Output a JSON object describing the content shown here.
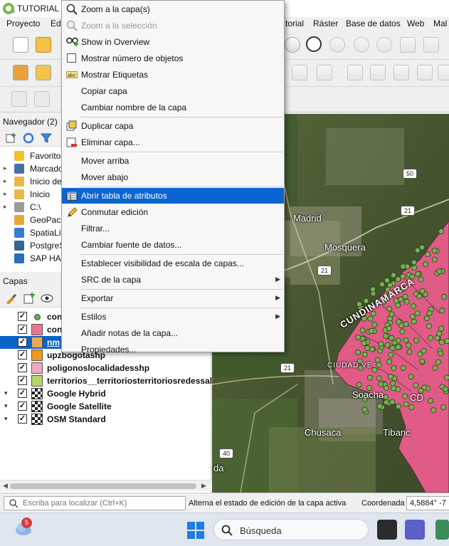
{
  "window": {
    "title": "TUTORIAL M"
  },
  "menubar": [
    "Proyecto",
    "Ed",
    "torial",
    "Ráster",
    "Base de datos",
    "Web",
    "Mal"
  ],
  "navigator": {
    "title": "Navegador (2)",
    "items": [
      {
        "label": "Favorito",
        "icon": "star-icon",
        "arrow": ""
      },
      {
        "label": "Marcado",
        "icon": "bookmark-icon",
        "arrow": "▸"
      },
      {
        "label": "Inicio de",
        "icon": "home-folder-icon",
        "arrow": "▸"
      },
      {
        "label": "Inicio",
        "icon": "folder-icon",
        "arrow": "▸"
      },
      {
        "label": "C:\\",
        "icon": "drive-icon",
        "arrow": "▸"
      },
      {
        "label": "GeoPack",
        "icon": "geopackage-icon",
        "arrow": ""
      },
      {
        "label": "SpatiaLit",
        "icon": "spatialite-icon",
        "arrow": ""
      },
      {
        "label": "PostgreS",
        "icon": "postgres-icon",
        "arrow": ""
      },
      {
        "label": "SAP HA",
        "icon": "sap-hana-icon",
        "arrow": ""
      }
    ]
  },
  "layers": {
    "title": "Capas",
    "rows": [
      {
        "label": "con",
        "symbol": "dot",
        "color": "#6ea84f",
        "expand": "",
        "selected": false
      },
      {
        "label": "con",
        "symbol": "fill",
        "color": "#e5788f",
        "expand": "",
        "selected": false
      },
      {
        "label": "nm",
        "symbol": "fill",
        "color": "#e8a95a",
        "expand": "",
        "selected": true
      },
      {
        "label": "upzbogotashp",
        "symbol": "fill",
        "color": "#f29a1a",
        "expand": "",
        "selected": false
      },
      {
        "label": "poligonoslocalidadesshp",
        "symbol": "fill",
        "color": "#f0a8c0",
        "expand": "",
        "selected": false
      },
      {
        "label": "territorios__territoriosterritoriosredessal",
        "symbol": "fill",
        "color": "#b7d56a",
        "expand": "",
        "selected": false
      },
      {
        "label": "Google Hybrid",
        "symbol": "checker",
        "color": "",
        "expand": "▾",
        "selected": false
      },
      {
        "label": "Google Satellite",
        "symbol": "checker",
        "color": "",
        "expand": "▾",
        "selected": false
      },
      {
        "label": "OSM Standard",
        "symbol": "checker",
        "color": "",
        "expand": "▾",
        "selected": false
      }
    ]
  },
  "context_menu": {
    "items": [
      {
        "label": "Zoom a la capa(s)",
        "icon": "zoom-layer-icon",
        "disabled": false,
        "submenu": false,
        "highlight": false
      },
      {
        "label": "Zoom a la selección",
        "icon": "zoom-selection-icon",
        "disabled": true,
        "submenu": false,
        "highlight": false
      },
      {
        "label": "Show in Overview",
        "icon": "overview-icon",
        "disabled": false,
        "submenu": false,
        "highlight": false
      },
      {
        "label": "Mostrar número de objetos",
        "icon": "checkbox-icon",
        "disabled": false,
        "submenu": false,
        "highlight": false
      },
      {
        "label": "Mostrar Etiquetas",
        "icon": "labels-icon",
        "disabled": false,
        "submenu": false,
        "highlight": false
      },
      {
        "label": "Copiar capa",
        "icon": "",
        "disabled": false,
        "submenu": false,
        "highlight": false
      },
      {
        "label": "Cambiar nombre de la capa",
        "icon": "",
        "disabled": false,
        "submenu": false,
        "highlight": false
      },
      {
        "label": "Duplicar capa",
        "icon": "duplicate-icon",
        "disabled": false,
        "submenu": false,
        "highlight": false
      },
      {
        "label": "Eliminar capa...",
        "icon": "remove-layer-icon",
        "disabled": false,
        "submenu": false,
        "highlight": false
      },
      {
        "label": "Mover arriba",
        "icon": "",
        "disabled": false,
        "submenu": false,
        "highlight": false
      },
      {
        "label": "Mover abajo",
        "icon": "",
        "disabled": false,
        "submenu": false,
        "highlight": false
      },
      {
        "label": "Abrir tabla de atributos",
        "icon": "attribute-table-icon",
        "disabled": false,
        "submenu": false,
        "highlight": true
      },
      {
        "label": "Conmutar edición",
        "icon": "pencil-icon",
        "disabled": false,
        "submenu": false,
        "highlight": false
      },
      {
        "label": "Filtrar...",
        "icon": "",
        "disabled": false,
        "submenu": false,
        "highlight": false
      },
      {
        "label": "Cambiar fuente de datos...",
        "icon": "",
        "disabled": false,
        "submenu": false,
        "highlight": false
      },
      {
        "label": "Establecer visibilidad de escala de capas...",
        "icon": "",
        "disabled": false,
        "submenu": false,
        "highlight": false
      },
      {
        "label": "SRC de la capa",
        "icon": "",
        "disabled": false,
        "submenu": true,
        "highlight": false
      },
      {
        "label": "Exportar",
        "icon": "",
        "disabled": false,
        "submenu": true,
        "highlight": false
      },
      {
        "label": "Estilos",
        "icon": "",
        "disabled": false,
        "submenu": true,
        "highlight": false
      },
      {
        "label": "Añadir notas de la capa...",
        "icon": "",
        "disabled": false,
        "submenu": false,
        "highlight": false
      },
      {
        "label": "Propiedades...",
        "icon": "",
        "disabled": false,
        "submenu": false,
        "highlight": false
      }
    ]
  },
  "map": {
    "labels": [
      "Madrid",
      "Mosquera",
      "CUNDINAMARCA",
      "CIUDAD VE",
      "Soacha",
      "CD",
      "Chusaca",
      "Tibanc",
      "da"
    ],
    "road_signs": [
      "50",
      "21",
      "21",
      "40"
    ],
    "polygon_color": "#e05c86",
    "point_color": "#78b24f"
  },
  "statusbar": {
    "locator_placeholder": "Escriba para localizar (Ctrl+K)",
    "message": "Alterna el estado de edición de la capa activa",
    "coord_label": "Coordenada",
    "coord_value": "4,5884° -7"
  },
  "taskbar": {
    "search_label": "Búsqueda",
    "badge": "5"
  },
  "colors": {
    "selection": "#0a64d2",
    "accent_green": "#7ab648"
  }
}
